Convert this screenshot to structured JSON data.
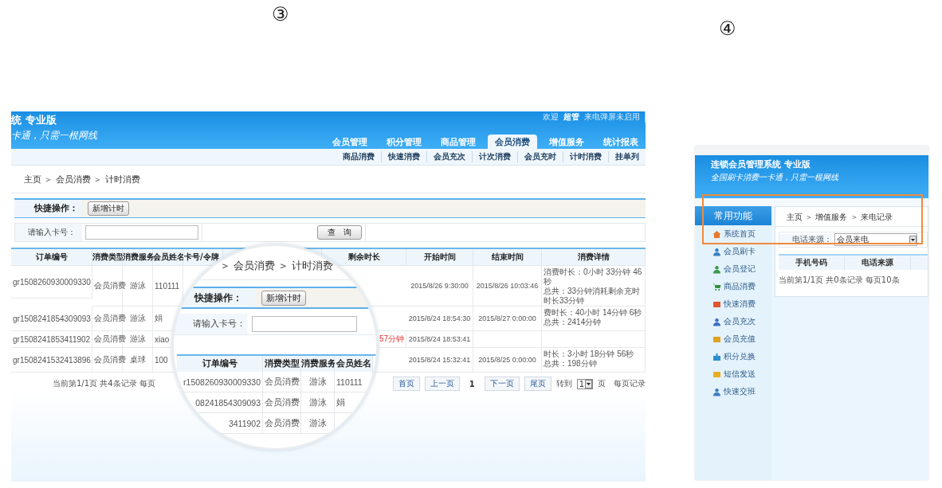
{
  "markers": [
    {
      "label": "③"
    },
    {
      "label": "④"
    }
  ],
  "main_screen": {
    "header": {
      "title": "统 专业版",
      "slogan": "卡通，只需一根网线",
      "welcome": "欢迎",
      "user": "超管",
      "status": "来电弹屏未启用"
    },
    "nav_tabs": [
      {
        "label": "会员管理",
        "selected": false
      },
      {
        "label": "积分管理",
        "selected": false
      },
      {
        "label": "商品管理",
        "selected": false
      },
      {
        "label": "会员消费",
        "selected": true
      },
      {
        "label": "增值服务",
        "selected": false
      },
      {
        "label": "统计报表",
        "selected": false
      }
    ],
    "sub_nav": [
      "商品消费",
      "快速消费",
      "会员充次",
      "计次消费",
      "会员充时",
      "计时消费",
      "挂单列"
    ],
    "breadcrumb": "主页 ＞ 会员消费 ＞ 计时消费",
    "quick_actions": {
      "label": "快捷操作：",
      "button": "新增计时"
    },
    "search": {
      "label": "请输入卡号：",
      "button": "查　询"
    },
    "table": {
      "columns": [
        {
          "label": "订单编号"
        },
        {
          "label": "消费类型"
        },
        {
          "label": "消费服务"
        },
        {
          "label": "会员姓名"
        },
        {
          "label": "卡号/令牌"
        },
        {},
        {},
        {
          "label": "剩余时长"
        },
        {
          "label": "开始时间"
        },
        {
          "label": "结束时间"
        },
        {
          "label": "消费详情"
        }
      ],
      "rows": [
        {
          "order_no": "gr1508260930009330",
          "type": "会员消费",
          "service": "游泳",
          "member": "110111",
          "start": "2015/8/26 9:30:00",
          "end": "2015/8/26 10:03:46",
          "details": [
            "消费时长：0小时 33分钟 46秒",
            "总共：33分钟消耗剩余充时时长33分钟"
          ]
        },
        {
          "order_no": "gr1508241854309093",
          "type": "会员消费",
          "service": "游泳",
          "member": "娟",
          "start": "2015/8/24 18:54:30",
          "end": "2015/8/27 0:00:00",
          "details": [
            "费时长：40小时 14分钟 6秒",
            "总共：2414分钟"
          ]
        },
        {
          "order_no": "gr1508241853411902",
          "type": "会员消费",
          "service": "游泳",
          "member": "xiao",
          "remaining": "57分钟",
          "alert": true,
          "start": "2015/8/24 18:53:41"
        },
        {
          "order_no": "gr1508241532413896",
          "type": "会员消费",
          "service": "桌球",
          "member": "100",
          "start": "2015/8/24 15:32:41",
          "end": "2015/8/25 0:00:00",
          "details": [
            "时长：3小时 18分钟 56秒",
            "总共：198分钟"
          ]
        }
      ]
    },
    "pagination": {
      "summary": "当前第1/1页 共4条记录 每页",
      "links": [
        {
          "label": "首页",
          "current": false
        },
        {
          "label": "上一页",
          "current": false
        },
        {
          "label": "1",
          "current": true
        },
        {
          "label": "下一页",
          "current": false
        },
        {
          "label": "尾页",
          "current": false
        }
      ],
      "goto_label": "转到",
      "page_select": "1",
      "page_unit": "页",
      "per_page_label": "每页记录"
    }
  },
  "magnifier": {
    "breadcrumb": "＞ 会员消费 ＞ 计时消费",
    "quick_label": "快捷操作：",
    "quick_button": "新增计时",
    "search_label": "请输入卡号：",
    "columns": [
      "订单编号",
      "消费类型",
      "消费服务",
      "会员姓名"
    ],
    "rows": [
      [
        "r1508260930009330",
        "会员消费",
        "游泳",
        "110111"
      ],
      [
        "08241854309093",
        "会员消费",
        "游泳",
        "娟"
      ],
      [
        "3411902",
        "会员消费",
        "游泳"
      ]
    ]
  },
  "second_screen": {
    "title": "连锁会员管理系统 专业版",
    "slogan": "全国刷卡消费一卡通，只需一根网线",
    "sidebar": {
      "title": "常用功能",
      "items": [
        "系统首页",
        "会员刷卡",
        "会员登记",
        "商品消费",
        "快速消费",
        "会员充次",
        "会员充值",
        "积分兑换",
        "短信发送",
        "快速交班"
      ]
    },
    "breadcrumb": "主页 ＞ 增值服务 ＞ 来电记录",
    "filter": {
      "label": "电话来源：",
      "value": "会员来电"
    },
    "table": {
      "columns": [
        "手机号码",
        "电话来源"
      ]
    },
    "summary": "当前第1/1页 共0条记录 每页10条"
  }
}
